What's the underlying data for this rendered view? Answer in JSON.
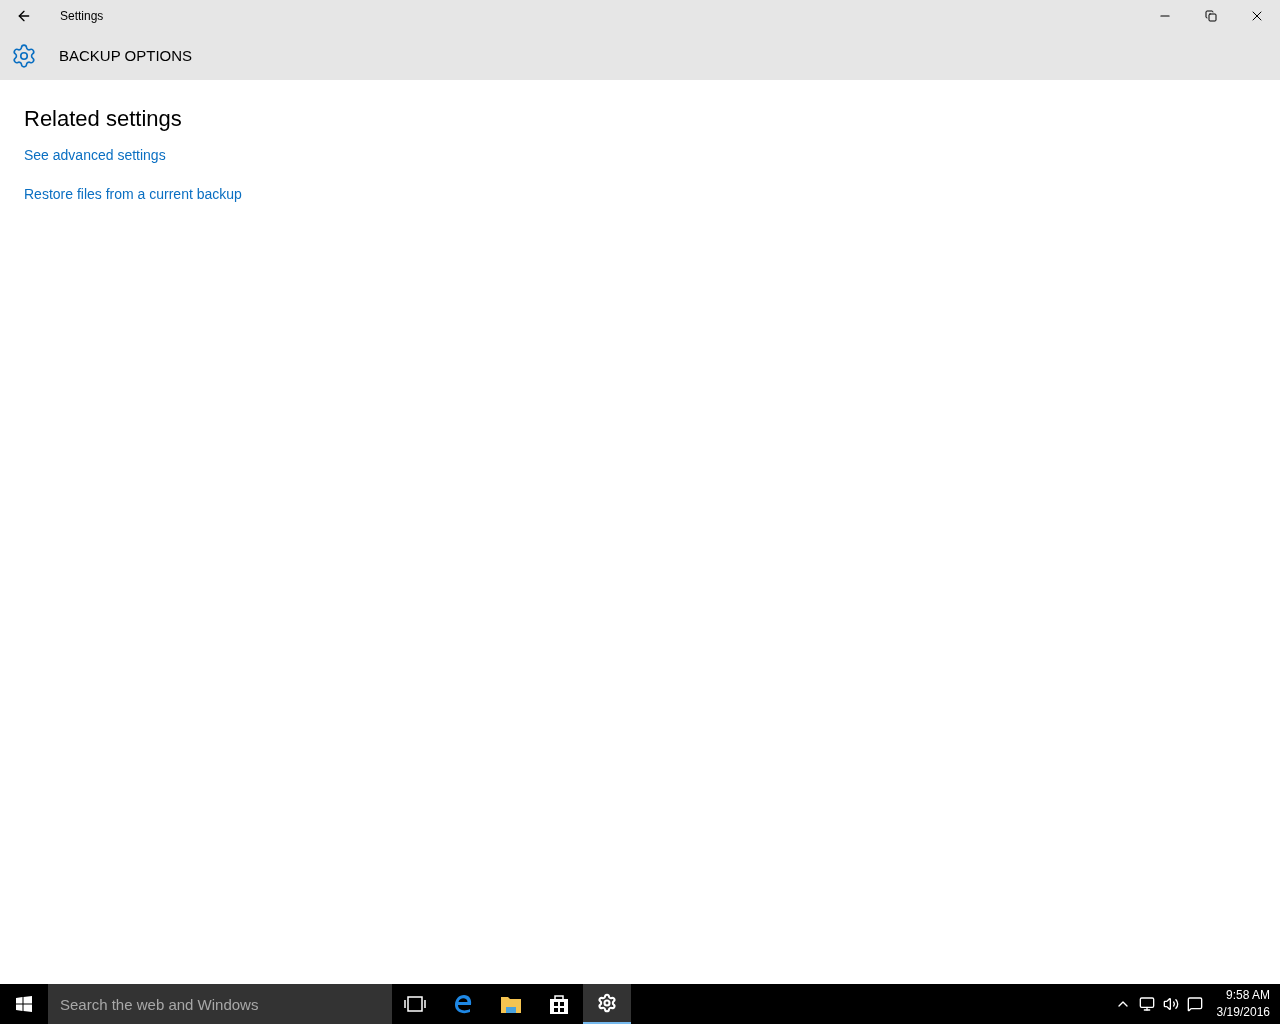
{
  "window": {
    "title": "Settings"
  },
  "header": {
    "title": "BACKUP OPTIONS"
  },
  "section": {
    "heading": "Related settings",
    "links": [
      "See advanced settings",
      "Restore files from a current backup"
    ]
  },
  "taskbar": {
    "search": {
      "placeholder": "Search the web and Windows"
    },
    "apps": [
      {
        "kind": "taskview",
        "selected": false
      },
      {
        "kind": "browser",
        "selected": false
      },
      {
        "kind": "folder",
        "selected": false
      },
      {
        "kind": "store",
        "selected": false
      },
      {
        "kind": "settings",
        "selected": true
      }
    ],
    "clock": {
      "time": "9:58 AM",
      "date": "3/19/2016"
    }
  }
}
